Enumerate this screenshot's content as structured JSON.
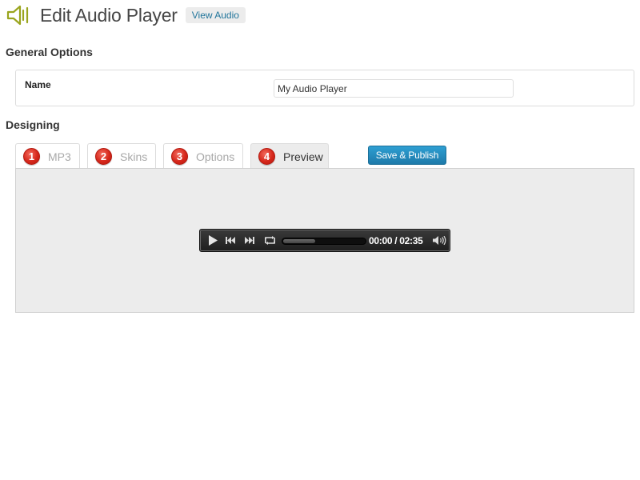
{
  "header": {
    "title": "Edit Audio Player",
    "view_button": "View Audio",
    "app_icon": "speaker-icon",
    "icon_color": "#9aa51e"
  },
  "general": {
    "heading": "General Options",
    "name_label": "Name",
    "name_value": "My Audio Player"
  },
  "designing": {
    "heading": "Designing",
    "tabs": [
      {
        "number": "1",
        "label": "MP3"
      },
      {
        "number": "2",
        "label": "Skins"
      },
      {
        "number": "3",
        "label": "Options"
      },
      {
        "number": "4",
        "label": "Preview"
      }
    ],
    "active_tab": "Preview",
    "publish_button": "Save & Publish"
  },
  "player": {
    "time": "00:00 / 02:35",
    "progress_buffered": 0.38,
    "progress_played": 0.0,
    "controls": [
      "play-icon",
      "previous-icon",
      "next-icon",
      "repeat-icon",
      "volume-icon"
    ]
  },
  "colors": {
    "accent_blue": "#21759b",
    "publish_button": "#2a8fc4",
    "tab_badge_red": "#d6271b",
    "preview_background": "#ececec",
    "player_background": "#2a2a2a"
  }
}
